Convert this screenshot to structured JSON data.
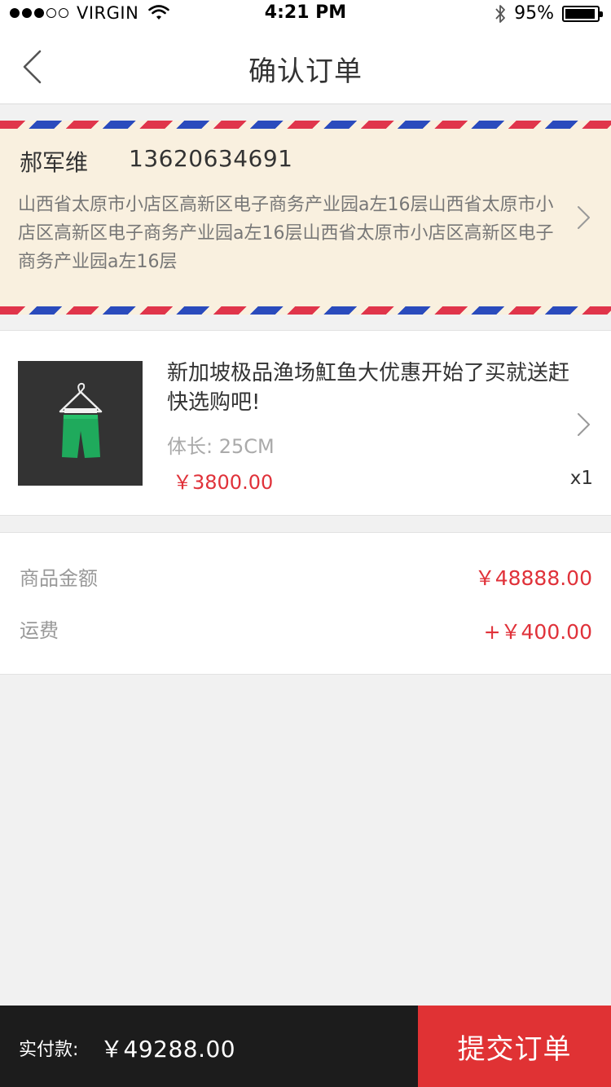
{
  "status_bar": {
    "carrier": "VIRGIN",
    "time": "4:21 PM",
    "battery_percent": "95%",
    "battery_level": 0.95,
    "signal_filled": 3,
    "signal_total": 5
  },
  "header": {
    "title": "确认订单",
    "back_icon": "chevron-left-icon"
  },
  "address": {
    "name": "郝军维",
    "phone": "13620634691",
    "full_address": "山西省太原市小店区高新区电子商务产业园a左16层山西省太原市小店区高新区电子商务产业园a左16层山西省太原市小店区高新区电子商务产业园a左16层"
  },
  "product": {
    "title": "新加坡极品渔场魟鱼大优惠开始了买就送赶快选购吧!",
    "spec": "体长: 25CM",
    "price": "￥3800.00",
    "quantity": "x1",
    "thumb_icon": "green-shorts-on-hanger"
  },
  "summary": {
    "goods_label": "商品金额",
    "goods_value": "￥48888.00",
    "shipping_label": "运费",
    "shipping_value": "+￥400.00"
  },
  "bottom_bar": {
    "total_label": "实付款:",
    "total_value": "￥49288.00",
    "submit_label": "提交订单"
  },
  "colors": {
    "accent_red": "#e0323a",
    "bottom_bar_bg": "#1c1c1c",
    "address_bg": "#f9f0df",
    "stripe_red": "#e0354b",
    "stripe_blue": "#2a4bbd"
  }
}
